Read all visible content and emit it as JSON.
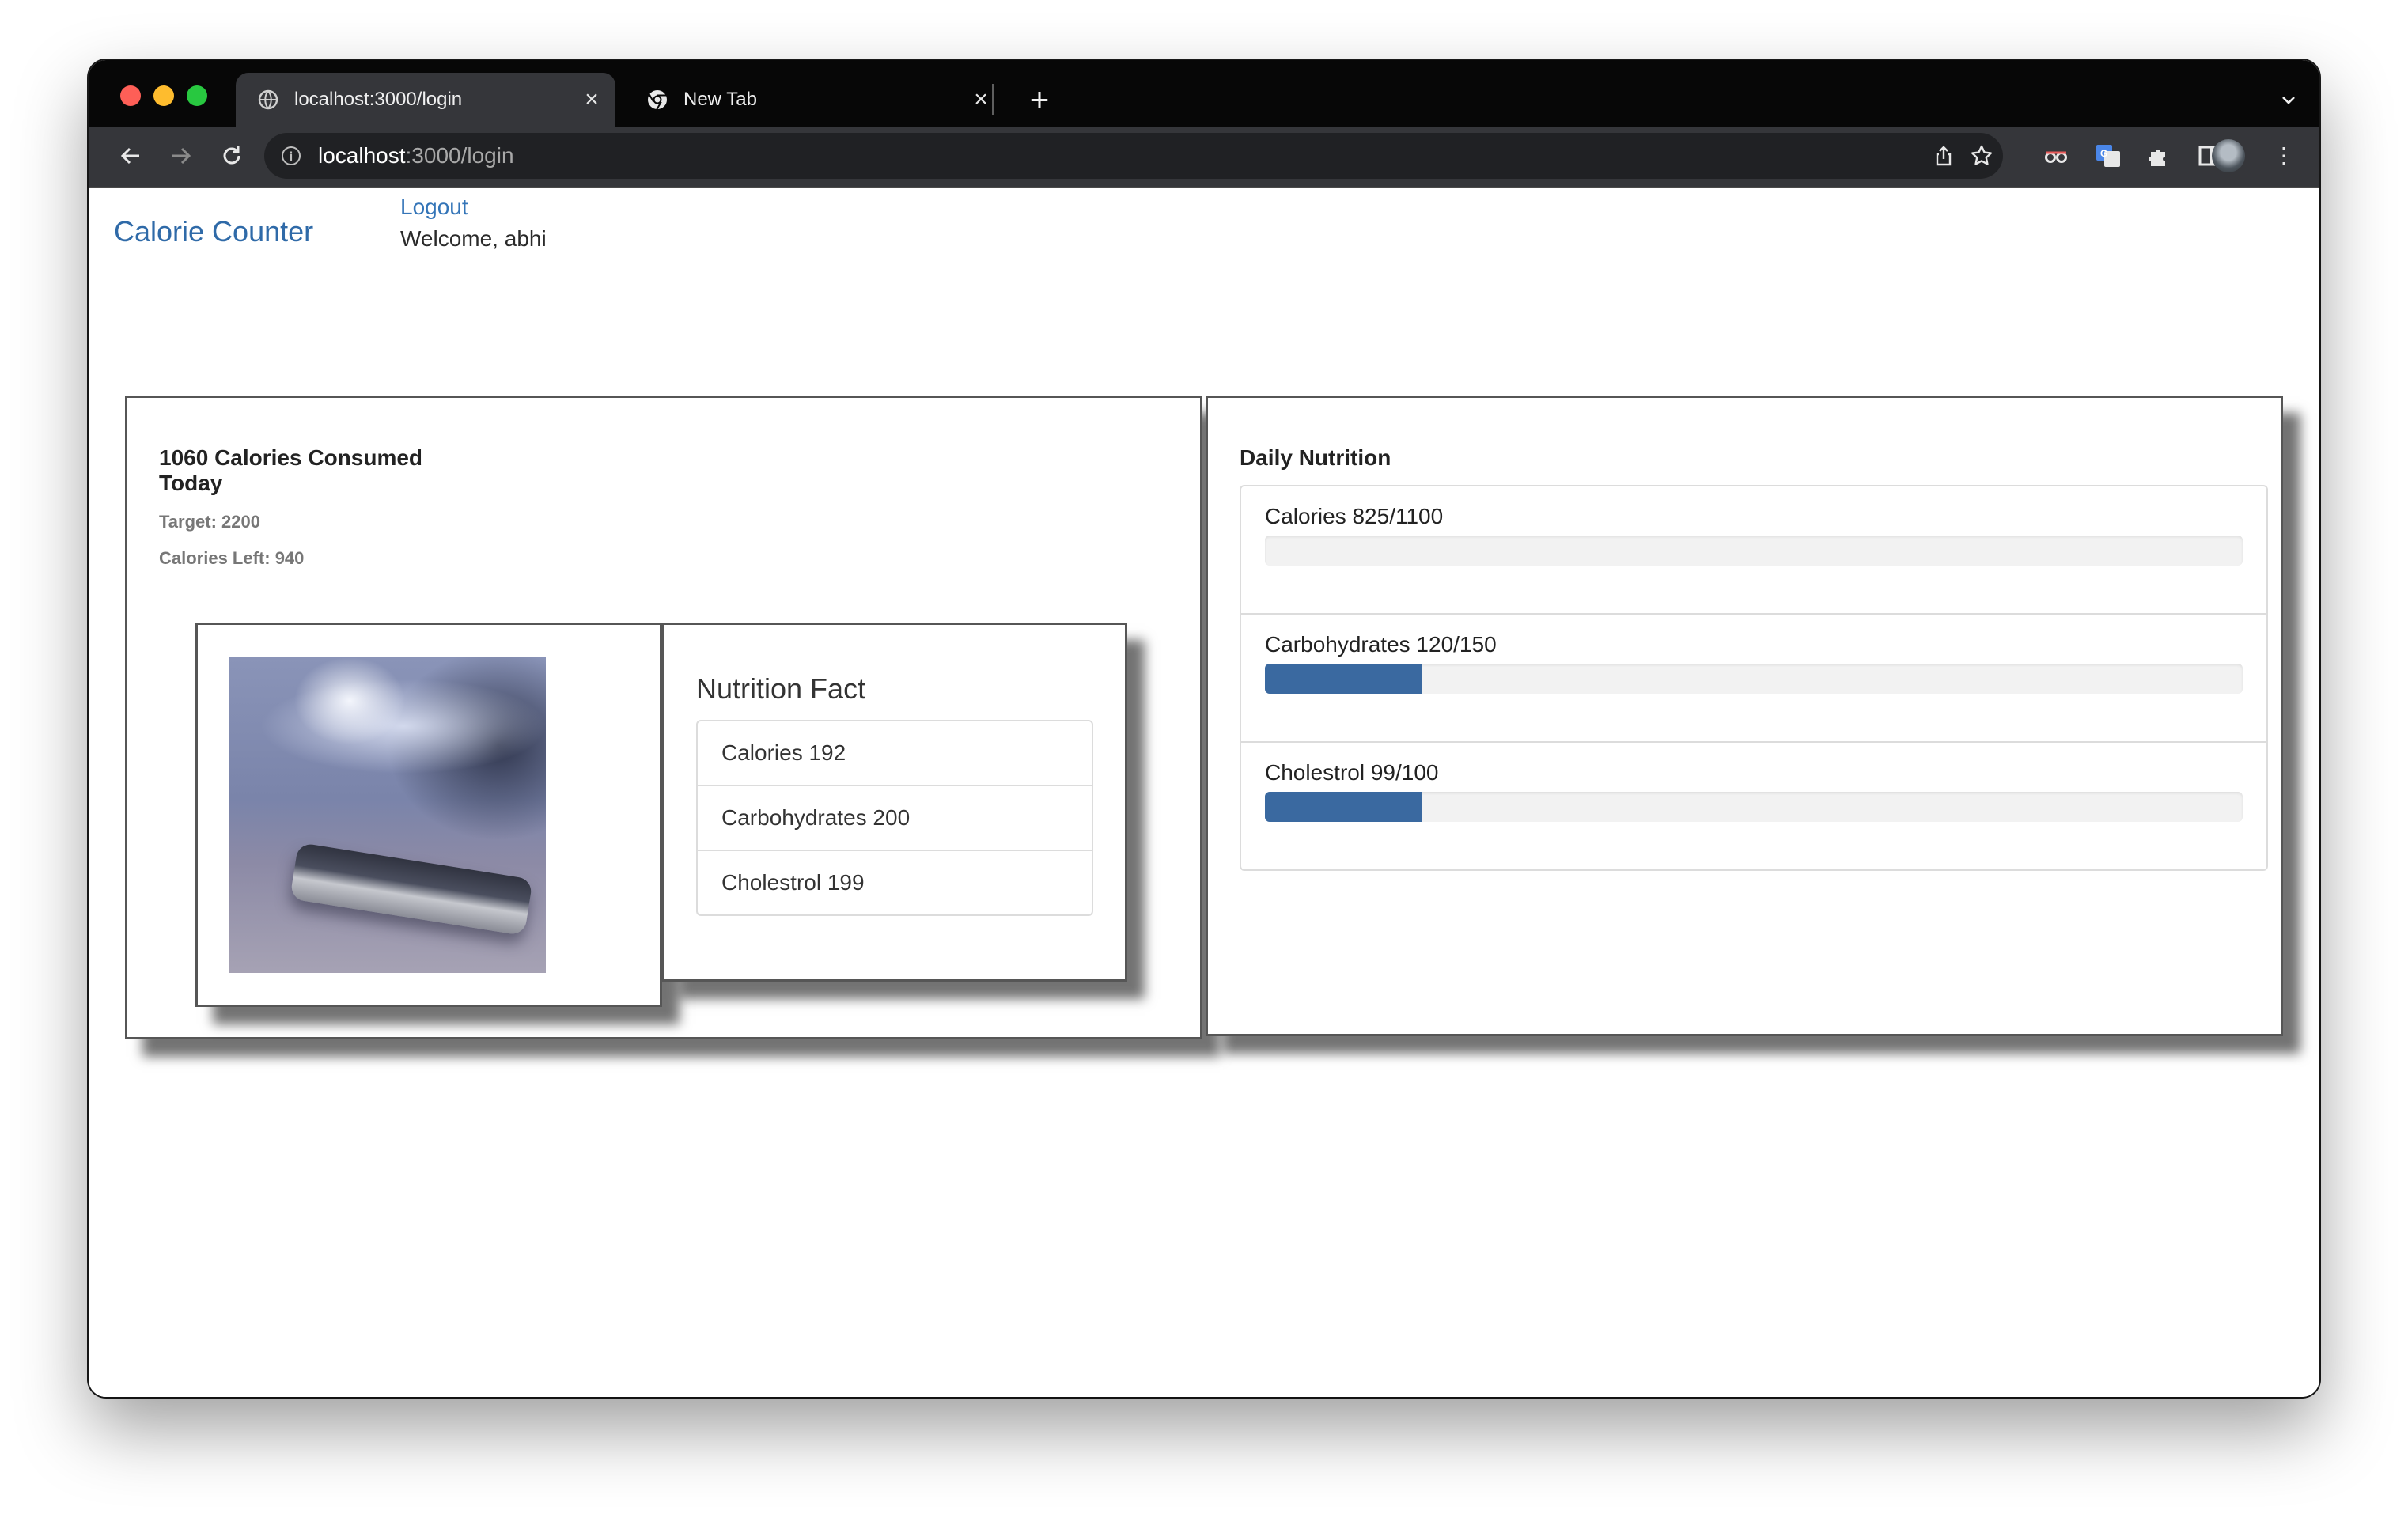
{
  "browser": {
    "tabs": [
      {
        "title": "localhost:3000/login",
        "favicon": "globe-icon",
        "active": true
      },
      {
        "title": "New Tab",
        "favicon": "chrome-icon",
        "active": false
      }
    ],
    "url_host": "localhost",
    "url_path": ":3000/login"
  },
  "app": {
    "brand": "Calorie Counter",
    "logout": "Logout",
    "welcome": "Welcome, abhi"
  },
  "summary": {
    "consumed": "1060 Calories Consumed Today",
    "target": "Target: 2200",
    "left": "Calories Left: 940"
  },
  "nutrition_fact": {
    "title": "Nutrition Fact",
    "items": [
      "Calories 192",
      "Carbohydrates 200",
      "Cholestrol 199"
    ]
  },
  "daily_nutrition": {
    "title": "Daily Nutrition",
    "items": [
      {
        "label": "Calories 825/1100",
        "fill_fraction": 0.0
      },
      {
        "label": "Carbohydrates 120/150",
        "fill_fraction": 0.16
      },
      {
        "label": "Cholestrol 99/100",
        "fill_fraction": 0.16
      }
    ]
  },
  "colors": {
    "link": "#3475b8",
    "progress": "#3a69a0",
    "panel_border": "#565656"
  }
}
